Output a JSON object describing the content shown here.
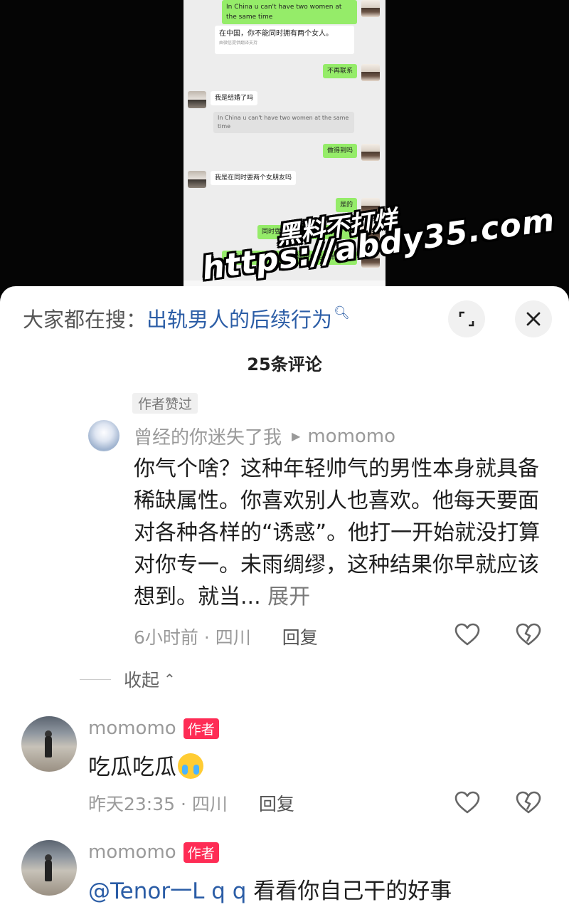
{
  "chat_screenshot": {
    "messages": [
      {
        "side": "right",
        "text": "In China u can't have two women at the same time"
      },
      {
        "side": "right",
        "text": "在中国，你不能同时拥有两个女人。",
        "note": "由微信提供翻译支持"
      },
      {
        "side": "right",
        "text": "不再联系"
      },
      {
        "side": "left",
        "text": "我是结婚了吗"
      },
      {
        "side": "left",
        "quote": "In China u can't have two women at the same time"
      },
      {
        "side": "right",
        "text": "做得到吗"
      },
      {
        "side": "left",
        "text": "我是在同时耍两个女朋友吗"
      },
      {
        "side": "right",
        "text": "是的"
      },
      {
        "side": "right",
        "text": "同时耍"
      },
      {
        "side": "right",
        "text": "这跟你结不结婚没关系，结婚也能这样吧"
      }
    ]
  },
  "watermark": {
    "line1": "黑料不打烊",
    "line2": "https://abdy35.com"
  },
  "sheet": {
    "search_prefix": "大家都在搜：",
    "search_link": "出轨男人的后续行为",
    "search_icon": "search-icon",
    "expand_icon": "expand-icon",
    "close_icon": "close-icon",
    "title": "25条评论"
  },
  "reply": {
    "liked_tag": "作者赞过",
    "user": "曾经的你迷失了我",
    "reply_to": "momomo",
    "text": "你气个啥？这种年轻帅气的男性本身就具备稀缺属性。你喜欢别人也喜欢。他每天要面对各种各样的“诱惑”。他打一开始就没打算对你专一。未雨绸缪，这种结果你早就应该想到。就当...",
    "more": "展开",
    "time_loc": "6小时前 · 四川",
    "reply_label": "回复"
  },
  "collapse_label": "收起",
  "comments": [
    {
      "user": "momomo",
      "badge": "作者",
      "text": "吃瓜吃瓜",
      "emoji": "crying-emoji",
      "time_loc": "昨天23:35 · 四川",
      "reply_label": "回复"
    },
    {
      "user": "momomo",
      "badge": "作者",
      "mention": "@Tenor一L q q",
      "text": " 看看你自己干的好事"
    }
  ],
  "colors": {
    "accent_red": "#fe2c55",
    "link_blue": "#2b5da6",
    "chat_green": "#95ec69"
  }
}
